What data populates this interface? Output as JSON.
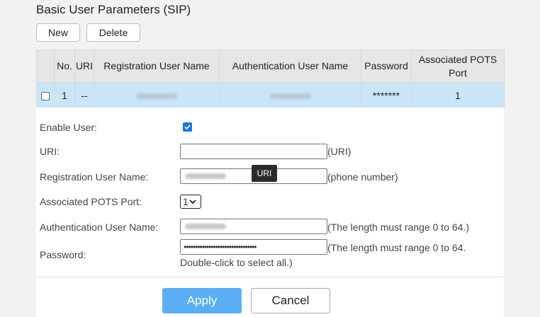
{
  "section": {
    "title": "Basic User Parameters (SIP)"
  },
  "toolbar": {
    "new_label": "New",
    "delete_label": "Delete"
  },
  "table": {
    "headers": [
      "",
      "No.",
      "URI",
      "Registration User Name",
      "Authentication User Name",
      "Password",
      "Associated POTS Port"
    ],
    "rows": [
      {
        "no": "1",
        "uri": "--",
        "registration_user_name": "",
        "authentication_user_name": "",
        "password": "*******",
        "associated_pots_port": "1"
      }
    ]
  },
  "form": {
    "enable_user": {
      "label": "Enable User:",
      "checked": true
    },
    "uri": {
      "label": "URI:",
      "value": "",
      "hint": "(URI)"
    },
    "registration_user_name": {
      "label": "Registration User Name:",
      "value": "",
      "hint": "(phone number)"
    },
    "associated_pots_port": {
      "label": "Associated POTS Port:",
      "value": "1"
    },
    "authentication_user_name": {
      "label": "Authentication User Name:",
      "value": "",
      "hint": "(The length must range 0 to 64.)"
    },
    "password": {
      "label": "Password:",
      "value": "••••••••••••••••••••••••••••••••",
      "hint_line1": "(The length must range 0 to 64.",
      "hint_line2": "Double-click to select all.)"
    }
  },
  "tooltip": {
    "text": "URI"
  },
  "actions": {
    "apply_label": "Apply",
    "cancel_label": "Cancel"
  },
  "colors": {
    "accent": "#5aaef5",
    "row_selected": "#c9e6f7",
    "checkbox": "#1a73e8"
  }
}
